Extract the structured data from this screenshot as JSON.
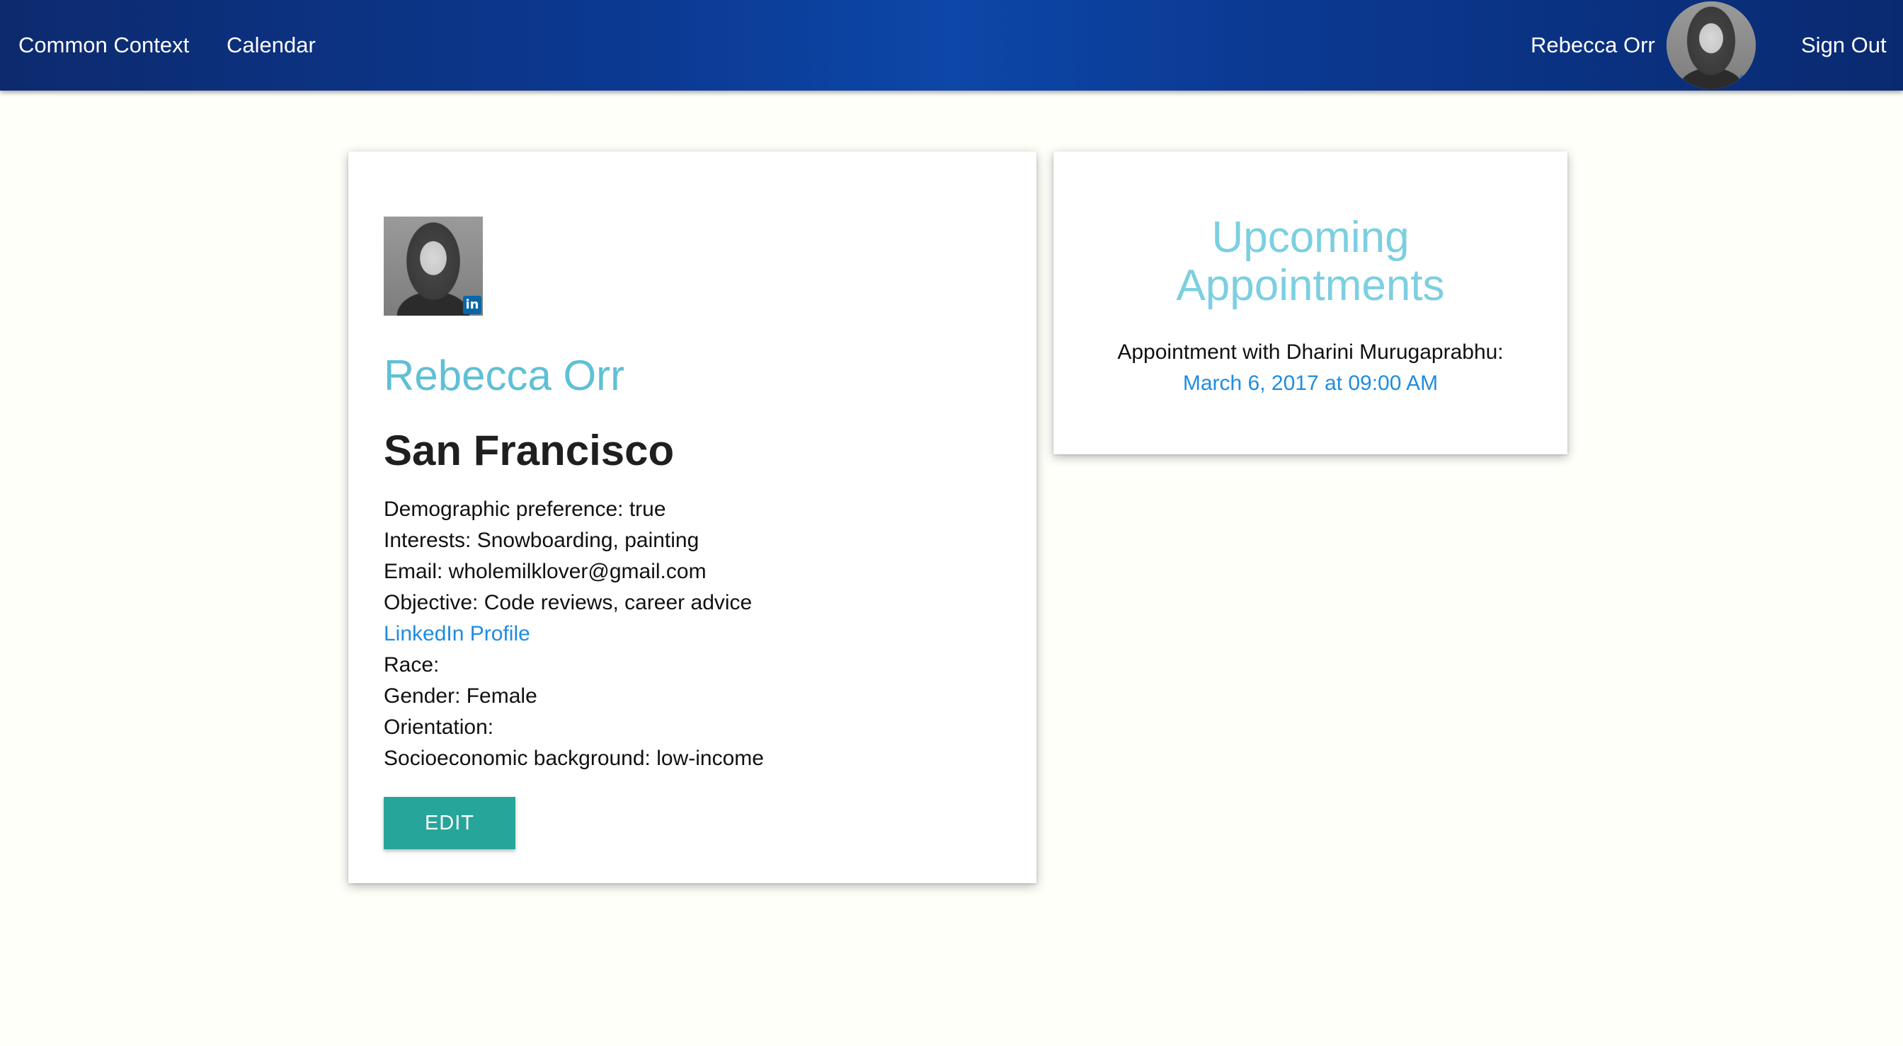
{
  "navbar": {
    "brand": "Common Context",
    "calendar": "Calendar",
    "user_name": "Rebecca Orr",
    "sign_out": "Sign Out"
  },
  "profile": {
    "name": "Rebecca Orr",
    "city": "San Francisco",
    "linkedin_badge": "in",
    "details": {
      "demographic": "Demographic preference: true",
      "interests": "Interests: Snowboarding, painting",
      "email": "Email: wholemilklover@gmail.com",
      "objective": "Objective: Code reviews, career advice",
      "linkedin_link": "LinkedIn Profile",
      "race": "Race:",
      "gender": "Gender: Female",
      "orientation": "Orientation:",
      "socioeconomic": "Socioeconomic background: low-income"
    },
    "edit_label": "EDIT"
  },
  "appointments": {
    "title_line1": "Upcoming",
    "title_line2": "Appointments",
    "items": [
      {
        "text": "Appointment with Dharini Murugaprabhu:",
        "date": "March 6, 2017 at 09:00 AM"
      }
    ]
  },
  "colors": {
    "navbar": "#0b3a94",
    "name_accent": "#5ec0d6",
    "link": "#1f8ce0",
    "edit_button": "#26a69a",
    "background": "#fffffa"
  }
}
